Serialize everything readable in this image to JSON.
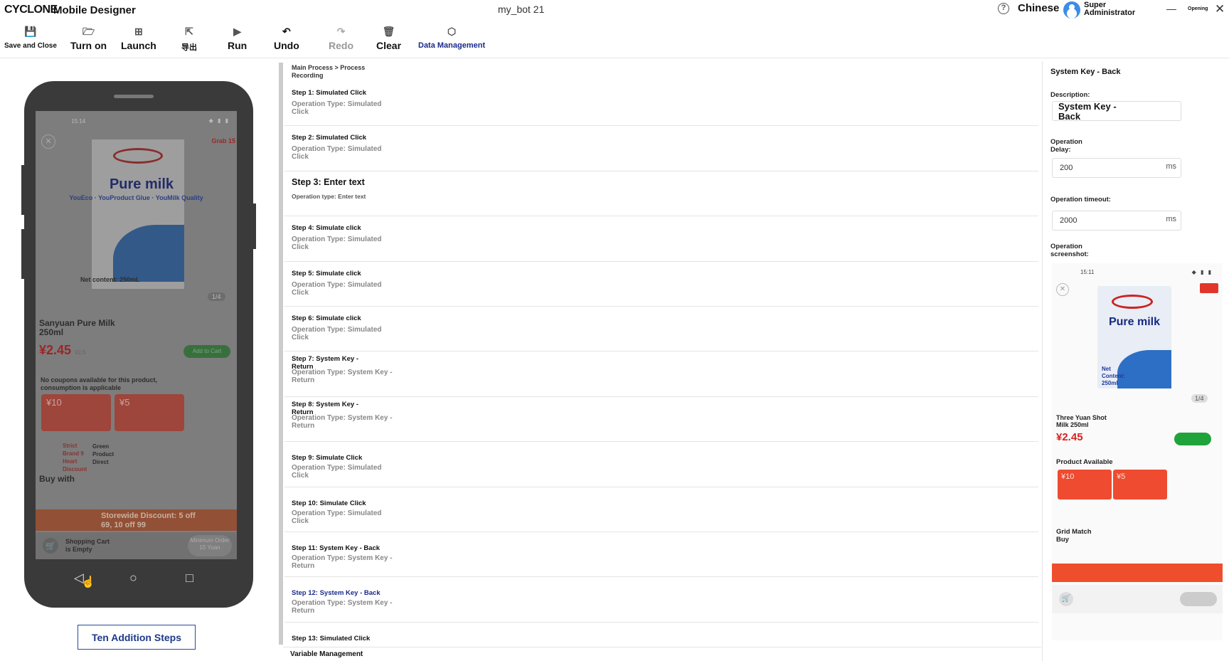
{
  "titlebar": {
    "logo": "CYCLONE",
    "app_name": "Mobile Designer",
    "doc_title": "my_bot 21",
    "help_icon": "?",
    "language": "Chinese",
    "user": "Super Administrator",
    "minimize": "—",
    "opening": "Opening",
    "close": "✕"
  },
  "toolbar": {
    "save_close": "Save and Close",
    "turn_on": "Turn on",
    "launch": "Launch",
    "export": "导出",
    "run": "Run",
    "undo": "Undo",
    "redo": "Redo",
    "clear": "Clear",
    "data_management": "Data Management"
  },
  "phone": {
    "time": "15:14",
    "grab": "Grab 15",
    "product_title": "Pure milk",
    "slogan": "YouEco · YouProduct Glue · YouMilk Quality",
    "net_content": "Net content: 250mL",
    "image_index": "1/4",
    "product_name": "Sanyuan Pure Milk 250ml",
    "price": "¥2.45",
    "price_old": "¥2.5",
    "add_to_cart": "Add to Cart",
    "coupon_note": "No coupons available for this product, consumption is applicable",
    "coupon1": "¥10",
    "coupon2": "¥5",
    "strict": "Strict Brand 9 Heart Discount",
    "green": "Green Product Direct",
    "buy_with": "Buy with",
    "storewide": "Storewide Discount: 5 off 69, 10 off 99",
    "cart_empty": "Shopping Cart is Empty",
    "minimum_order": "Minimum Order 15 Yuan"
  },
  "add_steps_button": "Ten Addition Steps",
  "breadcrumb": "Main Process > Process Recording",
  "steps": [
    {
      "title": "Step 1: Simulated Click",
      "desc": "Operation Type: Simulated Click"
    },
    {
      "title": "Step 2: Simulated Click",
      "desc": "Operation Type: Simulated Click"
    },
    {
      "title": "Step 3: Enter text",
      "desc": "Operation type: Enter text"
    },
    {
      "title": "Step 4: Simulate click",
      "desc": "Operation Type: Simulated Click"
    },
    {
      "title": "Step 5: Simulate click",
      "desc": "Operation Type: Simulated Click"
    },
    {
      "title": "Step 6: Simulate click",
      "desc": "Operation Type: Simulated Click"
    },
    {
      "title": "Step 7: System Key - Return",
      "desc": "Operation Type: System Key - Return"
    },
    {
      "title": "Step 8: System Key - Return",
      "desc": "Operation Type: System Key - Return"
    },
    {
      "title": "Step 9: Simulate Click",
      "desc": "Operation Type: Simulated Click"
    },
    {
      "title": "Step 10: Simulate Click",
      "desc": "Operation Type: Simulated Click"
    },
    {
      "title": "Step 11: System Key - Back",
      "desc": "Operation Type: System Key - Return"
    },
    {
      "title": "Step 12: System Key - Back",
      "desc": "Operation Type: System Key - Return"
    },
    {
      "title": "Step 13: Simulated Click",
      "desc": ""
    }
  ],
  "variable_management": "Variable Management",
  "panel": {
    "title": "System Key - Back",
    "description_label": "Description:",
    "description_value": "System Key - Back",
    "delay_label": "Operation Delay:",
    "delay_value": "200",
    "timeout_label": "Operation timeout:",
    "timeout_value": "2000",
    "unit": "ms",
    "screenshot_label": "Operation screenshot:",
    "shot": {
      "time": "15:11",
      "title": "Pure milk",
      "net": "Net Content: 250ml",
      "index": "1/4",
      "name": "Three Yuan Shot Milk 250ml",
      "price": "¥2.45",
      "available": "Product Available",
      "coupon1": "¥10",
      "coupon2": "¥5",
      "grid": "Grid Match Buy"
    }
  }
}
